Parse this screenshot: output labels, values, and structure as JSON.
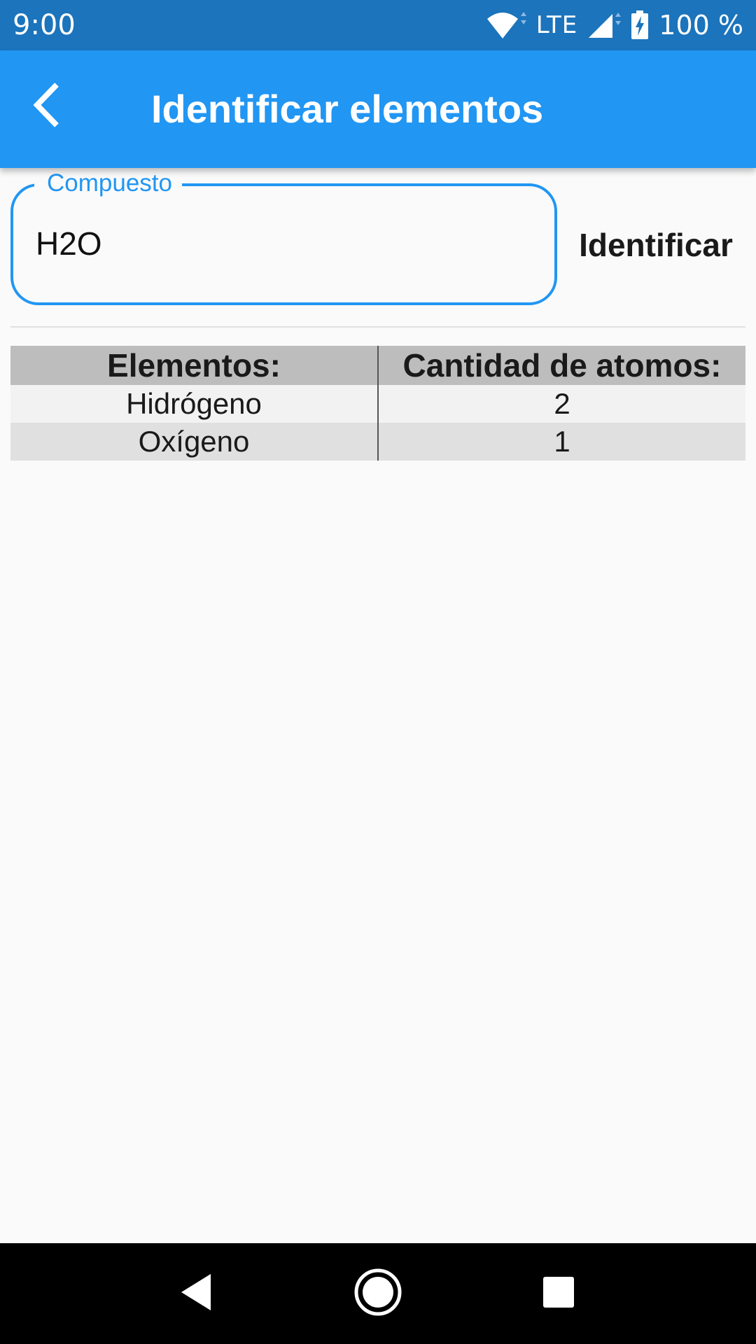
{
  "status_bar": {
    "time": "9:00",
    "network": "LTE",
    "battery": "100 %",
    "icons": [
      "wifi-icon",
      "signal-icon",
      "battery-charging-icon"
    ]
  },
  "app_bar": {
    "back_icon": "chevron-left-icon",
    "title": "Identificar elementos",
    "color": "#2196f3"
  },
  "form": {
    "field_label": "Compuesto",
    "field_value": "H2O",
    "button_label": "Identificar",
    "accent_color": "#2196f3"
  },
  "table": {
    "headers": [
      "Elementos:",
      "Cantidad de atomos:"
    ],
    "rows": [
      [
        "Hidrógeno",
        "2"
      ],
      [
        "Oxígeno",
        "1"
      ]
    ]
  },
  "nav_bar": {
    "icons": [
      "back-triangle-icon",
      "home-circle-icon",
      "recents-square-icon"
    ]
  }
}
